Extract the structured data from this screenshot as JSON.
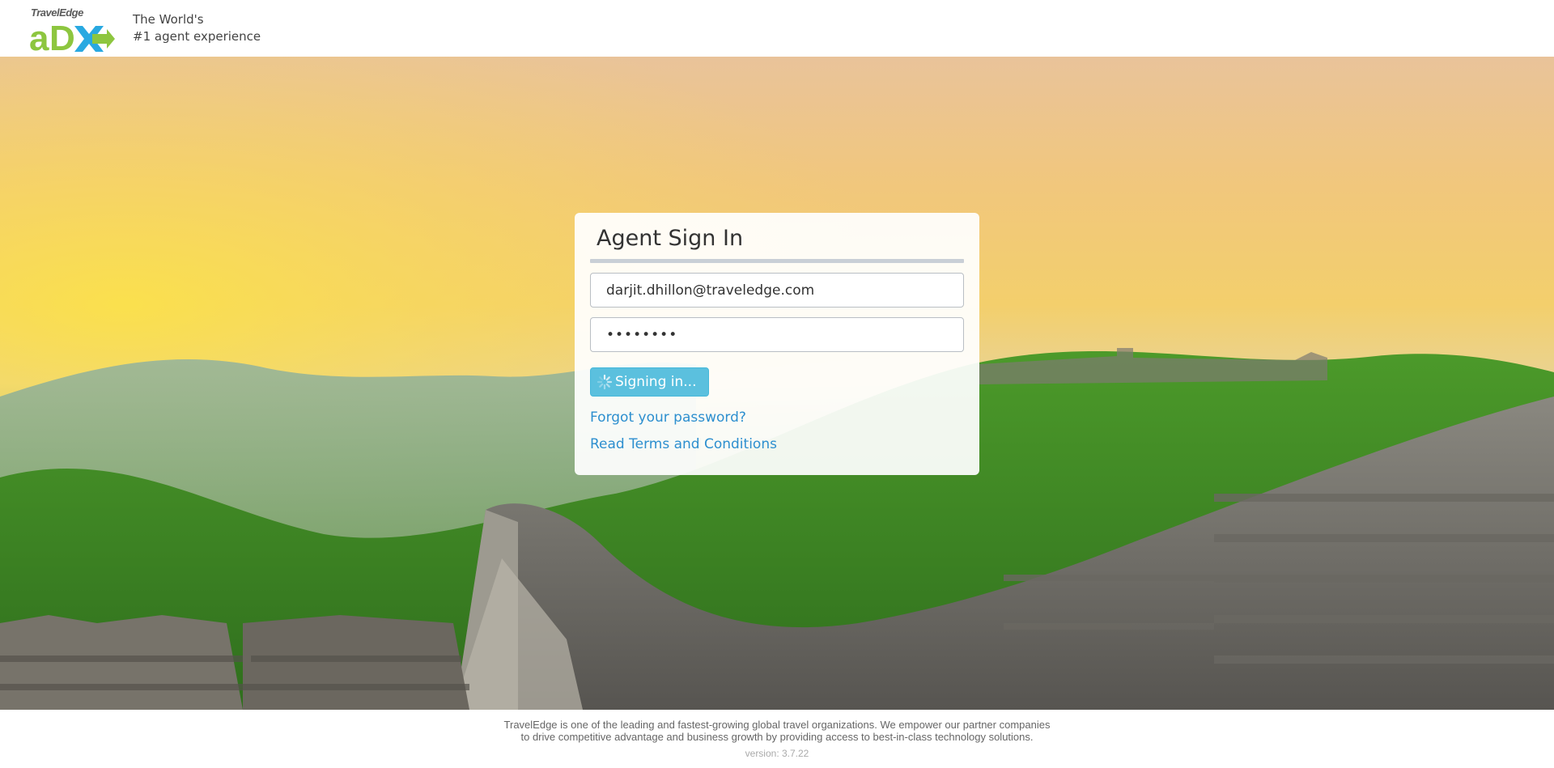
{
  "header": {
    "logo_brand": "TravelEdge",
    "logo_mark": "aDX",
    "tagline_line1": "The World's",
    "tagline_line2": "#1 agent experience"
  },
  "signin": {
    "title": "Agent Sign In",
    "username_value": "darjit.dhillon@traveledge.com",
    "password_value": "••••••••",
    "submit_label": "Signing in...",
    "submit_icon": "spinner-icon",
    "forgot_link": "Forgot your password?",
    "terms_link": "Read Terms and Conditions"
  },
  "footer": {
    "about_line1": "TravelEdge is one of the leading and fastest-growing global travel organizations. We empower our partner companies",
    "about_line2": "to drive competitive advantage and business growth by providing access to best-in-class technology solutions.",
    "version": "version: 3.7.22"
  },
  "colors": {
    "accent_button": "#5bc0de",
    "link": "#2d8fcf",
    "logo_green": "#8dc63f",
    "logo_blue": "#29a9e1"
  }
}
